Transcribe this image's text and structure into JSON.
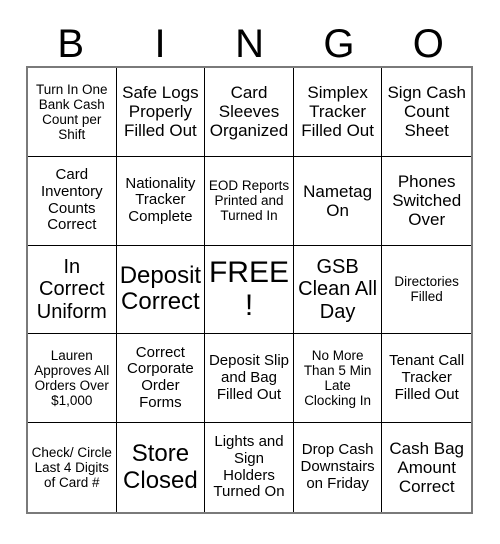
{
  "header": {
    "letters": [
      "B",
      "I",
      "N",
      "G",
      "O"
    ]
  },
  "grid": {
    "rows": 5,
    "columns": 5,
    "cells": [
      {
        "text": "Turn In One Bank Cash Count per Shift",
        "size": "fs-xs"
      },
      {
        "text": "Safe Logs Properly Filled Out",
        "size": "fs-md"
      },
      {
        "text": "Card Sleeves Organized",
        "size": "fs-md"
      },
      {
        "text": "Simplex Tracker Filled Out",
        "size": "fs-md"
      },
      {
        "text": "Sign Cash Count Sheet",
        "size": "fs-md"
      },
      {
        "text": "Card Inventory Counts Correct",
        "size": "fs-sm"
      },
      {
        "text": "Nationality Tracker Complete",
        "size": "fs-sm"
      },
      {
        "text": "EOD Reports Printed and Turned In",
        "size": "fs-xs"
      },
      {
        "text": "Nametag On",
        "size": "fs-md"
      },
      {
        "text": "Phones Switched Over",
        "size": "fs-md"
      },
      {
        "text": "In Correct Uniform",
        "size": "fs-lg"
      },
      {
        "text": "Deposit Correct",
        "size": "fs-xl"
      },
      {
        "text": "FREE!",
        "size": "fs-xxl"
      },
      {
        "text": "GSB Clean All Day",
        "size": "fs-lg"
      },
      {
        "text": "Directories Filled",
        "size": "fs-xs"
      },
      {
        "text": "Lauren Approves All Orders Over $1,000",
        "size": "fs-xs"
      },
      {
        "text": "Correct Corporate Order Forms",
        "size": "fs-sm"
      },
      {
        "text": "Deposit Slip and Bag Filled Out",
        "size": "fs-sm"
      },
      {
        "text": "No More Than 5 Min Late Clocking In",
        "size": "fs-xs"
      },
      {
        "text": "Tenant Call Tracker Filled Out",
        "size": "fs-sm"
      },
      {
        "text": "Check/ Circle Last 4 Digits of Card #",
        "size": "fs-xs"
      },
      {
        "text": "Store Closed",
        "size": "fs-xl"
      },
      {
        "text": "Lights and Sign Holders Turned On",
        "size": "fs-sm"
      },
      {
        "text": "Drop Cash Downstairs on Friday",
        "size": "fs-sm"
      },
      {
        "text": "Cash Bag Amount Correct",
        "size": "fs-md"
      }
    ]
  },
  "colors": {
    "background": "#ffffff",
    "text": "#000000",
    "cell_border": "#000000",
    "outer_border": "#7a7a7a"
  }
}
